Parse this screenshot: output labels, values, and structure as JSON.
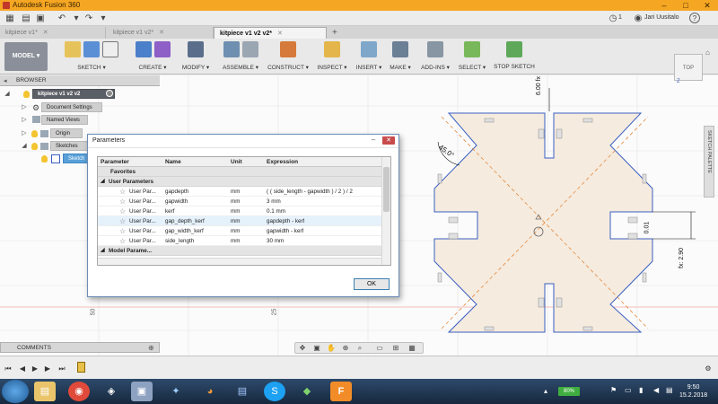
{
  "window": {
    "title": "Autodesk Fusion 360"
  },
  "quick_access": {
    "jobs_count": "1",
    "user_name": "Jari Uusitalo",
    "help": "?"
  },
  "tabs": [
    {
      "label": "kitpiece v1*"
    },
    {
      "label": "kitpiece v1 v2*"
    },
    {
      "label": "kitpiece v1 v2 v2*"
    }
  ],
  "ribbon": {
    "mode_label": "MODEL",
    "groups": [
      {
        "label": "SKETCH"
      },
      {
        "label": "CREATE"
      },
      {
        "label": "MODIFY"
      },
      {
        "label": "ASSEMBLE"
      },
      {
        "label": "CONSTRUCT"
      },
      {
        "label": "INSPECT"
      },
      {
        "label": "INSERT"
      },
      {
        "label": "MAKE"
      },
      {
        "label": "ADD-INS"
      },
      {
        "label": "SELECT"
      },
      {
        "label": "STOP SKETCH"
      }
    ]
  },
  "browser": {
    "title": "BROWSER",
    "root": "kitpiece v1 v2 v2",
    "nodes": [
      "Document Settings",
      "Named Views",
      "Origin",
      "Sketches",
      "Sketch"
    ]
  },
  "view_cube": {
    "label": "TOP",
    "axis_z": "Z"
  },
  "sketch_palette": {
    "label": "SKETCH PALETTE"
  },
  "canvas": {
    "dims": {
      "top": "6.00 fx",
      "right": "0.01",
      "right_fx": "fx: 2.90",
      "angle": "45.0°"
    },
    "axis_labels": [
      "50",
      "25"
    ]
  },
  "parameters_dialog": {
    "title": "Parameters",
    "columns": [
      "Parameter",
      "Name",
      "Unit",
      "Expression"
    ],
    "favorites_label": "Favorites",
    "user_params_label": "User Parameters",
    "model_params_label": "Model Parame...",
    "rows": [
      {
        "param": "User Par...",
        "name": "gapdepth",
        "unit": "mm",
        "expr": "( ( side_length - gapwidth ) / 2 ) / 2"
      },
      {
        "param": "User Par...",
        "name": "gapwidth",
        "unit": "mm",
        "expr": "3 mm"
      },
      {
        "param": "User Par...",
        "name": "kerf",
        "unit": "mm",
        "expr": "0.1 mm"
      },
      {
        "param": "User Par...",
        "name": "gap_depth_kerf",
        "unit": "mm",
        "expr": "gapdepth - kerf"
      },
      {
        "param": "User Par...",
        "name": "gap_width_kerf",
        "unit": "mm",
        "expr": "gapwidth - kerf"
      },
      {
        "param": "User Par...",
        "name": "side_length",
        "unit": "mm",
        "expr": "30 mm"
      }
    ],
    "ok_label": "OK"
  },
  "comments": {
    "title": "COMMENTS"
  },
  "taskbar": {
    "battery": "80%",
    "time": "9:50",
    "date": "15.2.2018"
  },
  "colors": {
    "title_bar": "#f5a623",
    "sketch_fill": "#f5ebdf",
    "sketch_line": "#3a5fc2",
    "construction_line": "#e58a3c",
    "dialog_border": "#6b8db5"
  }
}
